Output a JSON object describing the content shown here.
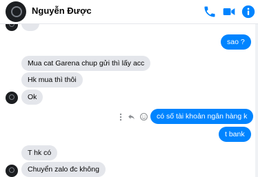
{
  "header": {
    "contact_name": "Nguyễn Được",
    "icons": [
      "phone-icon",
      "video-camera-icon",
      "info-icon"
    ],
    "accent_color": "#0084ff"
  },
  "messages": [
    {
      "side": "in",
      "text": ""
    },
    {
      "side": "out",
      "text": "sao ?"
    },
    {
      "side": "in",
      "text": "Mua cat Garena chup gửi thì lấy acc"
    },
    {
      "side": "in",
      "text": "Hk mua thì thôi"
    },
    {
      "side": "in",
      "text": "Ok"
    },
    {
      "side": "out",
      "text": "có số tài khoản ngân hàng k"
    },
    {
      "side": "out",
      "text": "t bank"
    },
    {
      "side": "in",
      "text": "T hk có"
    },
    {
      "side": "in",
      "text": "Chuyển zalo đc không"
    }
  ],
  "message_actions": [
    "more-icon",
    "reply-icon",
    "react-icon"
  ]
}
